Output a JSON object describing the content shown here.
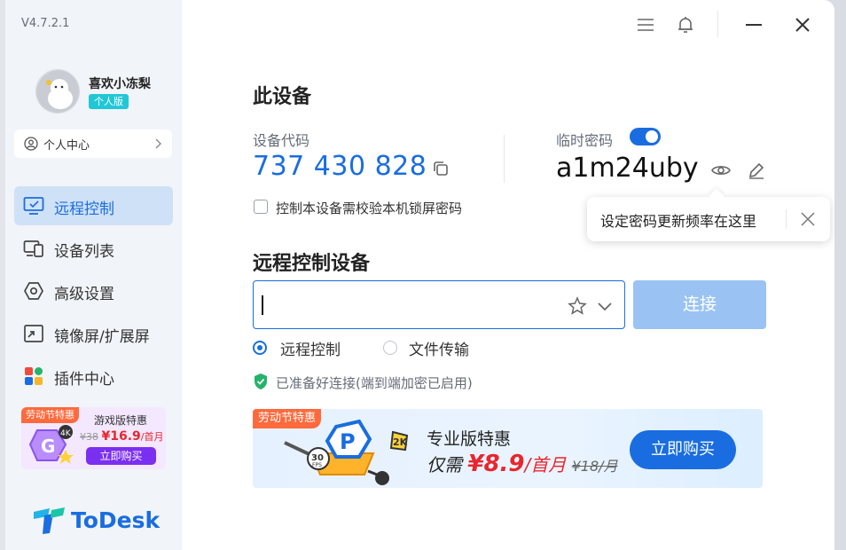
{
  "app": {
    "version": "V4.7.2.1",
    "brand": "ToDesk",
    "accent_color": "#1a6de0"
  },
  "user": {
    "name": "喜欢小冻梨",
    "plan_badge": "个人版",
    "personal_center": "个人中心"
  },
  "sidebar": {
    "items": [
      {
        "label": "远程控制",
        "icon": "monitor-icon",
        "active": true
      },
      {
        "label": "设备列表",
        "icon": "devices-icon",
        "active": false
      },
      {
        "label": "高级设置",
        "icon": "hexagon-settings-icon",
        "active": false
      },
      {
        "label": "镜像屏/扩展屏",
        "icon": "screen-mirror-icon",
        "active": false
      },
      {
        "label": "插件中心",
        "icon": "plugin-grid-icon",
        "active": false
      }
    ],
    "promo": {
      "tag": "劳动节特惠",
      "title": "游戏版特惠",
      "old_price": "¥38",
      "price": "¥16.9",
      "unit": "/首月",
      "button": "立即购买"
    }
  },
  "topbar": {
    "icons": [
      "menu-icon",
      "bell-icon",
      "minimize-icon",
      "close-icon"
    ]
  },
  "this_device": {
    "title": "此设备",
    "code_label": "设备代码",
    "code": "737 430 828",
    "temp_password_label": "临时密码",
    "temp_password_enabled": true,
    "temp_password": "a1m24uby",
    "lock_check_label": "控制本设备需校验本机锁屏密码",
    "lock_check_checked": false
  },
  "tooltip": {
    "text": "设定密码更新频率在这里"
  },
  "remote": {
    "title": "远程控制设备",
    "input_value": "",
    "connect_button": "连接",
    "modes": [
      {
        "label": "远程控制",
        "selected": true
      },
      {
        "label": "文件传输",
        "selected": false
      }
    ],
    "status": "已准备好连接(端到端加密已启用)"
  },
  "banner": {
    "tag": "劳动节特惠",
    "line1": "专业版特惠",
    "line2_prefix": "仅需",
    "price": "¥8.9",
    "unit": "/首月",
    "old_price": "¥18/月",
    "button": "立即购买",
    "art_labels": {
      "fps": "30",
      "fps_unit": "FPS",
      "letter": "P",
      "res": "2K"
    }
  }
}
